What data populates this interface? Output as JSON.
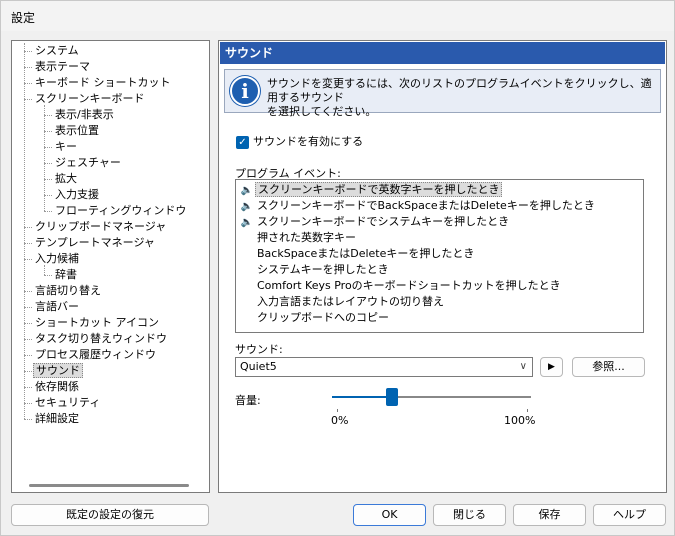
{
  "window": {
    "title": "設定"
  },
  "tree": {
    "items": [
      {
        "label": "システム",
        "level": 0
      },
      {
        "label": "表示テーマ",
        "level": 0
      },
      {
        "label": "キーボード ショートカット",
        "level": 0
      },
      {
        "label": "スクリーンキーボード",
        "level": 0
      },
      {
        "label": "表示/非表示",
        "level": 1
      },
      {
        "label": "表示位置",
        "level": 1
      },
      {
        "label": "キー",
        "level": 1
      },
      {
        "label": "ジェスチャー",
        "level": 1
      },
      {
        "label": "拡大",
        "level": 1
      },
      {
        "label": "入力支援",
        "level": 1
      },
      {
        "label": "フローティングウィンドウ",
        "level": 1
      },
      {
        "label": "クリップボードマネージャ",
        "level": 0
      },
      {
        "label": "テンプレートマネージャ",
        "level": 0
      },
      {
        "label": "入力候補",
        "level": 0
      },
      {
        "label": "辞書",
        "level": 1
      },
      {
        "label": "言語切り替え",
        "level": 0
      },
      {
        "label": "言語バー",
        "level": 0
      },
      {
        "label": "ショートカット アイコン",
        "level": 0
      },
      {
        "label": "タスク切り替えウィンドウ",
        "level": 0
      },
      {
        "label": "プロセス履歴ウィンドウ",
        "level": 0
      },
      {
        "label": "サウンド",
        "level": 0,
        "selected": true
      },
      {
        "label": "依存関係",
        "level": 0
      },
      {
        "label": "セキュリティ",
        "level": 0
      },
      {
        "label": "詳細設定",
        "level": 0
      }
    ]
  },
  "panel": {
    "title": "サウンド",
    "info_line1": "サウンドを変更するには、次のリストのプログラムイベントをクリックし、適用するサウンド",
    "info_line2": "を選択してください。",
    "enable_label": "サウンドを有効にする",
    "events_label": "プログラム イベント:",
    "events": [
      {
        "label": "スクリーンキーボードで英数字キーを押したとき",
        "has_sound": true,
        "selected": true
      },
      {
        "label": "スクリーンキーボードでBackSpaceまたはDeleteキーを押したとき",
        "has_sound": true
      },
      {
        "label": "スクリーンキーボードでシステムキーを押したとき",
        "has_sound": true
      },
      {
        "label": "押された英数字キー",
        "has_sound": false
      },
      {
        "label": "BackSpaceまたはDeleteキーを押したとき",
        "has_sound": false
      },
      {
        "label": "システムキーを押したとき",
        "has_sound": false
      },
      {
        "label": "Comfort Keys Proのキーボードショートカットを押したとき",
        "has_sound": false
      },
      {
        "label": "入力言語またはレイアウトの切り替え",
        "has_sound": false
      },
      {
        "label": "クリップボードへのコピー",
        "has_sound": false
      }
    ],
    "sound_label": "サウンド:",
    "sound_value": "Quiet5",
    "browse_label": "参照...",
    "volume_label": "音量:",
    "volume_value": 0.3,
    "volume_min": "0%",
    "volume_max": "100%"
  },
  "buttons": {
    "restore": "既定の設定の復元",
    "ok": "OK",
    "close": "閉じる",
    "save": "保存",
    "help": "ヘルプ"
  },
  "colors": {
    "header": "#2a5aad",
    "accent": "#0063b1"
  }
}
